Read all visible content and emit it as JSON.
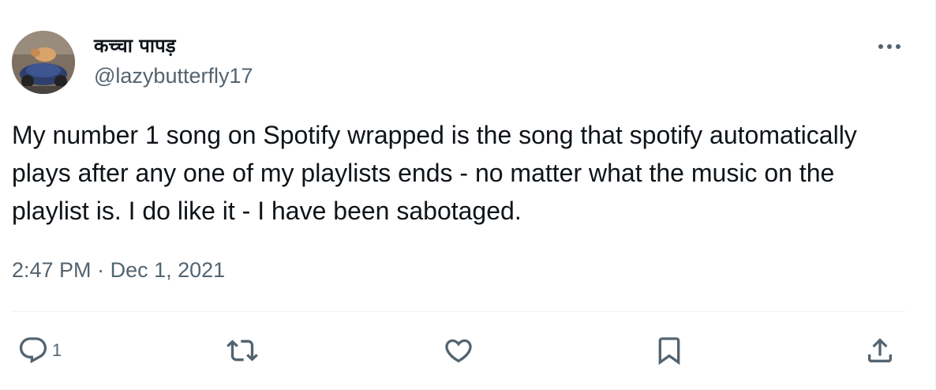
{
  "author": {
    "display_name": "कच्चा पापड़",
    "handle": "@lazybutterfly17"
  },
  "tweet": {
    "text": "My number 1 song on Spotify wrapped is the song that spotify automatically plays after any one of my playlists ends - no matter what the music on the playlist is. I do like it - I have been sabotaged.",
    "time": "2:47 PM",
    "separator": "·",
    "date": "Dec 1, 2021"
  },
  "actions": {
    "reply_count": "1"
  },
  "icons": {
    "more": "more-horizontal-icon",
    "reply": "reply-icon",
    "retweet": "retweet-icon",
    "like": "like-icon",
    "bookmark": "bookmark-icon",
    "share": "share-icon"
  },
  "colors": {
    "text": "#0f1419",
    "secondary": "#536471",
    "divider": "#eff3f4"
  }
}
